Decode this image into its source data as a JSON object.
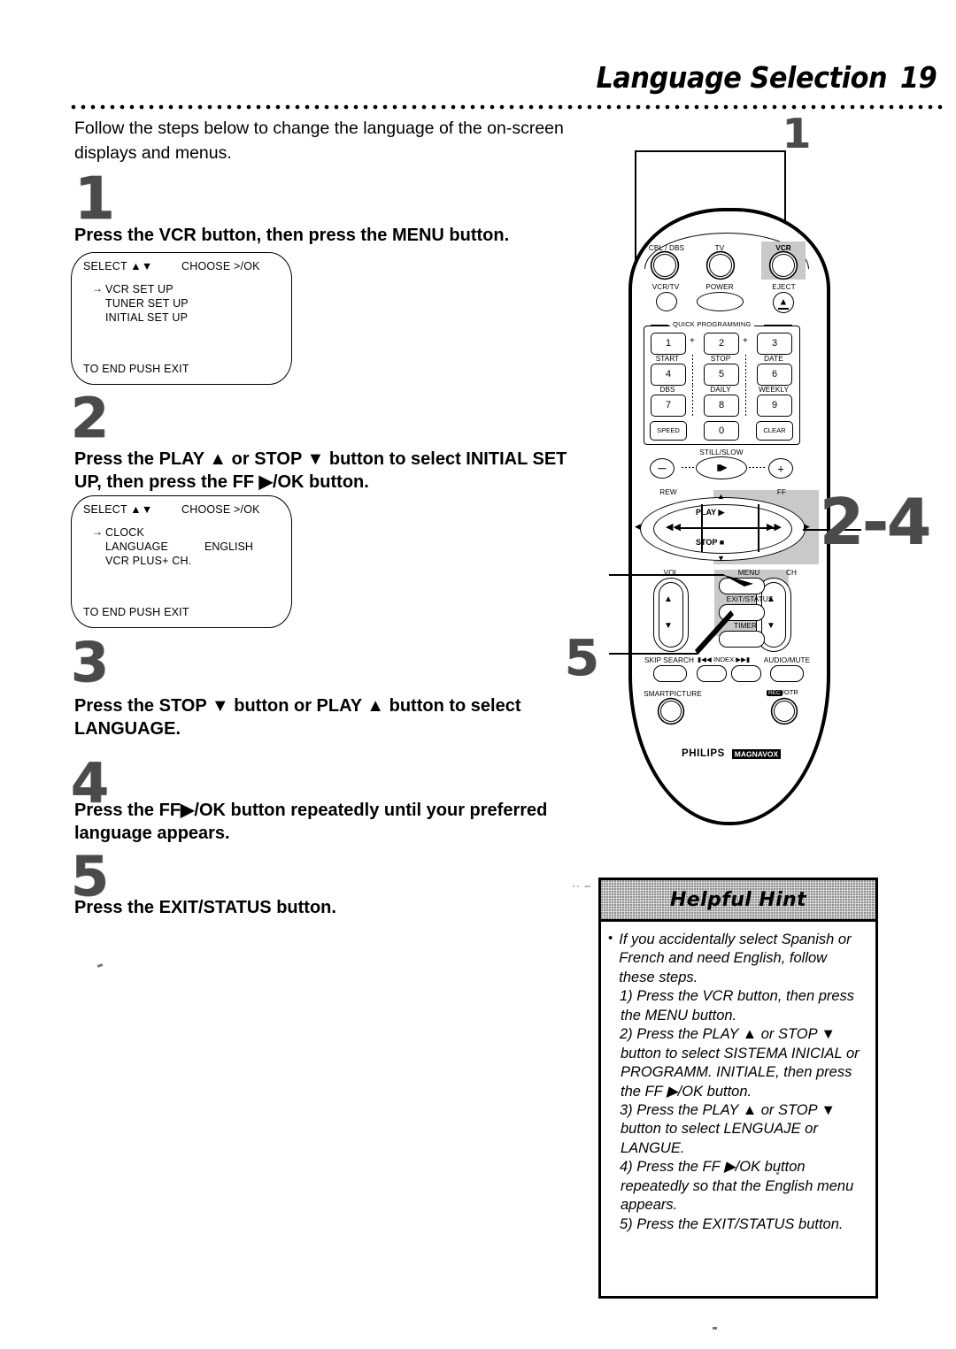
{
  "header": {
    "title": "Language Selection",
    "page_number": "19"
  },
  "intro": "Follow the steps below to change the language of the on-screen displays and menus.",
  "steps": [
    {
      "number": "1",
      "text_html": "Press the VCR button, then press the MENU button.",
      "osd": {
        "select_label": "SELECT ▲▼",
        "choose_label": "CHOOSE >/OK",
        "cursor": "→",
        "items": [
          "VCR SET UP",
          "TUNER SET UP",
          "INITIAL SET UP"
        ],
        "values": [
          "",
          "",
          ""
        ],
        "footer": "TO END PUSH EXIT"
      }
    },
    {
      "number": "2",
      "text_html": "Press the PLAY ▲ or STOP ▼ button to select INITIAL SET UP, then press the FF ▶/OK button.",
      "osd": {
        "select_label": "SELECT ▲▼",
        "choose_label": "CHOOSE >/OK",
        "cursor": "→",
        "items": [
          "CLOCK",
          "LANGUAGE",
          "VCR PLUS+ CH."
        ],
        "values": [
          "",
          "ENGLISH",
          ""
        ],
        "footer": "TO END PUSH EXIT"
      }
    },
    {
      "number": "3",
      "text_html": "Press the STOP ▼ button or PLAY ▲ button to select LANGUAGE."
    },
    {
      "number": "4",
      "text_html": "Press the FF▶/OK button repeatedly until your preferred language appears."
    },
    {
      "number": "5",
      "text_html": "Press the EXIT/STATUS button."
    }
  ],
  "callouts": {
    "top": "1",
    "middle": "2-4",
    "bottom": "5"
  },
  "remote": {
    "brand": "PHILIPS",
    "sub_brand": "MAGNAVOX",
    "row1": [
      "CBL / DBS",
      "TV",
      "VCR"
    ],
    "row2": [
      "VCR/TV",
      "POWER",
      "EJECT"
    ],
    "quick_programming_label": "QUICK PROGRAMMING",
    "keys": [
      {
        "key": "1",
        "label": "START"
      },
      {
        "key": "2",
        "label": "STOP"
      },
      {
        "key": "3",
        "label": "DATE"
      },
      {
        "key": "4",
        "label": "DBS"
      },
      {
        "key": "5",
        "label": "DAILY"
      },
      {
        "key": "6",
        "label": "WEEKLY"
      },
      {
        "key": "7",
        "label": ""
      },
      {
        "key": "8",
        "label": ""
      },
      {
        "key": "9",
        "label": ""
      }
    ],
    "bottom_keys": [
      "SPEED",
      "0",
      "CLEAR"
    ],
    "still_slow_label": "STILL/SLOW",
    "minus": "−",
    "plus": "+",
    "transport": {
      "rew": "REW",
      "ff": "FF",
      "play": "PLAY",
      "stop": "STOP"
    },
    "vol_label": "VOL",
    "ch_label": "CH",
    "menu_label": "MENU",
    "exit_status_label": "EXIT/STATUS",
    "timer_label": "TIMER",
    "skip_search_label": "SKIP SEARCH",
    "index_label": "INDEX",
    "audio_mute_label": "AUDIO/MUTE",
    "smartpicture_label": "SMARTPICTURE",
    "rec_label": "REC",
    "otr_label": "/OTR"
  },
  "hint": {
    "title": "Helpful Hint",
    "bullet_intro": "If you accidentally select Spanish or French and need English, follow these steps.",
    "lines": [
      "1) Press the VCR button, then press the MENU button.",
      "2) Press the PLAY ▲ or STOP ▼ button to select SISTEMA INICIAL or PROGRAMM. INITIALE, then press the FF ▶/OK button.",
      "3) Press the PLAY ▲ or STOP ▼ button to select LENGUAJE or LANGUE.",
      "4) Press the FF ▶/OK button repeatedly so that the English menu appears.",
      "5) Press the EXIT/STATUS button."
    ]
  },
  "colors": {
    "ink": "#000000",
    "highlight": "#c9c9c9",
    "halftone": "#4a4a4a"
  }
}
